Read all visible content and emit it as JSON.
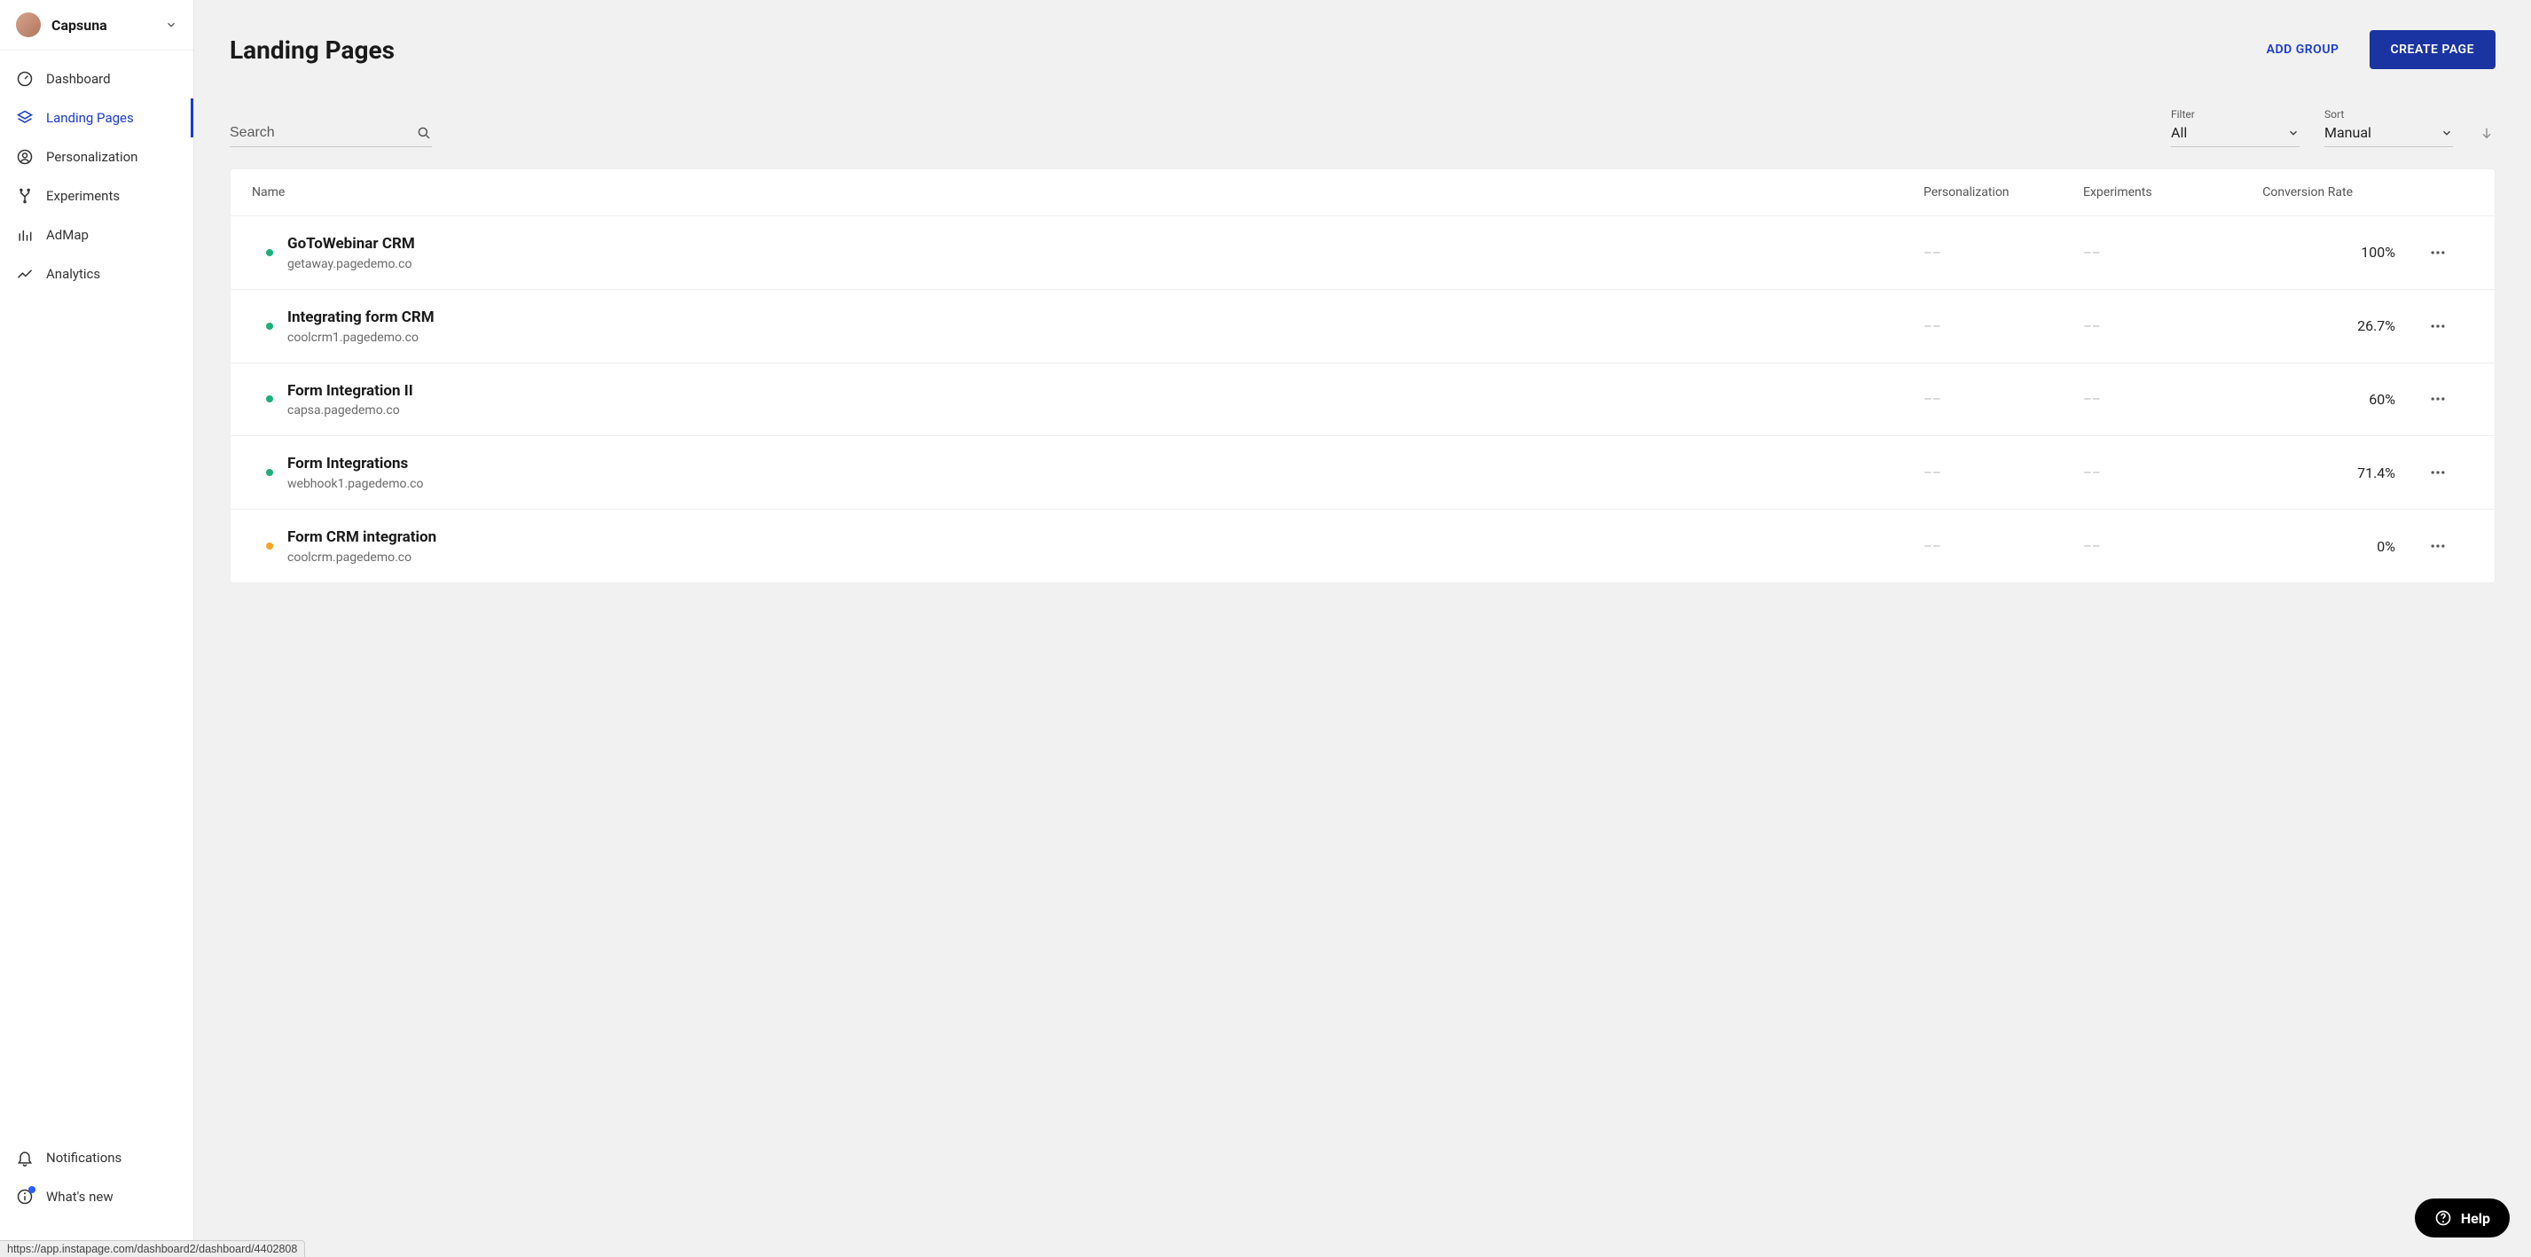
{
  "workspace": {
    "name": "Capsuna"
  },
  "sidebar": {
    "items": [
      {
        "label": "Dashboard"
      },
      {
        "label": "Landing Pages"
      },
      {
        "label": "Personalization"
      },
      {
        "label": "Experiments"
      },
      {
        "label": "AdMap"
      },
      {
        "label": "Analytics"
      }
    ],
    "bottom": [
      {
        "label": "Notifications"
      },
      {
        "label": "What's new"
      }
    ]
  },
  "header": {
    "title": "Landing Pages",
    "add_group": "ADD GROUP",
    "create_page": "CREATE PAGE"
  },
  "controls": {
    "search_placeholder": "Search",
    "filter_label": "Filter",
    "filter_value": "All",
    "sort_label": "Sort",
    "sort_value": "Manual"
  },
  "table": {
    "columns": {
      "name": "Name",
      "personalization": "Personalization",
      "experiments": "Experiments",
      "rate": "Conversion Rate"
    },
    "rows": [
      {
        "status": "green",
        "name": "GoToWebinar CRM",
        "url": "getaway.pagedemo.co",
        "personalization": "––",
        "experiments": "––",
        "rate": "100%"
      },
      {
        "status": "green",
        "name": "Integrating form CRM",
        "url": "coolcrm1.pagedemo.co",
        "personalization": "––",
        "experiments": "––",
        "rate": "26.7%"
      },
      {
        "status": "green",
        "name": "Form Integration II",
        "url": "capsa.pagedemo.co",
        "personalization": "––",
        "experiments": "––",
        "rate": "60%"
      },
      {
        "status": "green",
        "name": "Form Integrations",
        "url": "webhook1.pagedemo.co",
        "personalization": "––",
        "experiments": "––",
        "rate": "71.4%"
      },
      {
        "status": "orange",
        "name": "Form CRM integration",
        "url": "coolcrm.pagedemo.co",
        "personalization": "––",
        "experiments": "––",
        "rate": "0%"
      }
    ]
  },
  "help": {
    "label": "Help"
  },
  "status_link": "https://app.instapage.com/dashboard2/dashboard/4402808"
}
